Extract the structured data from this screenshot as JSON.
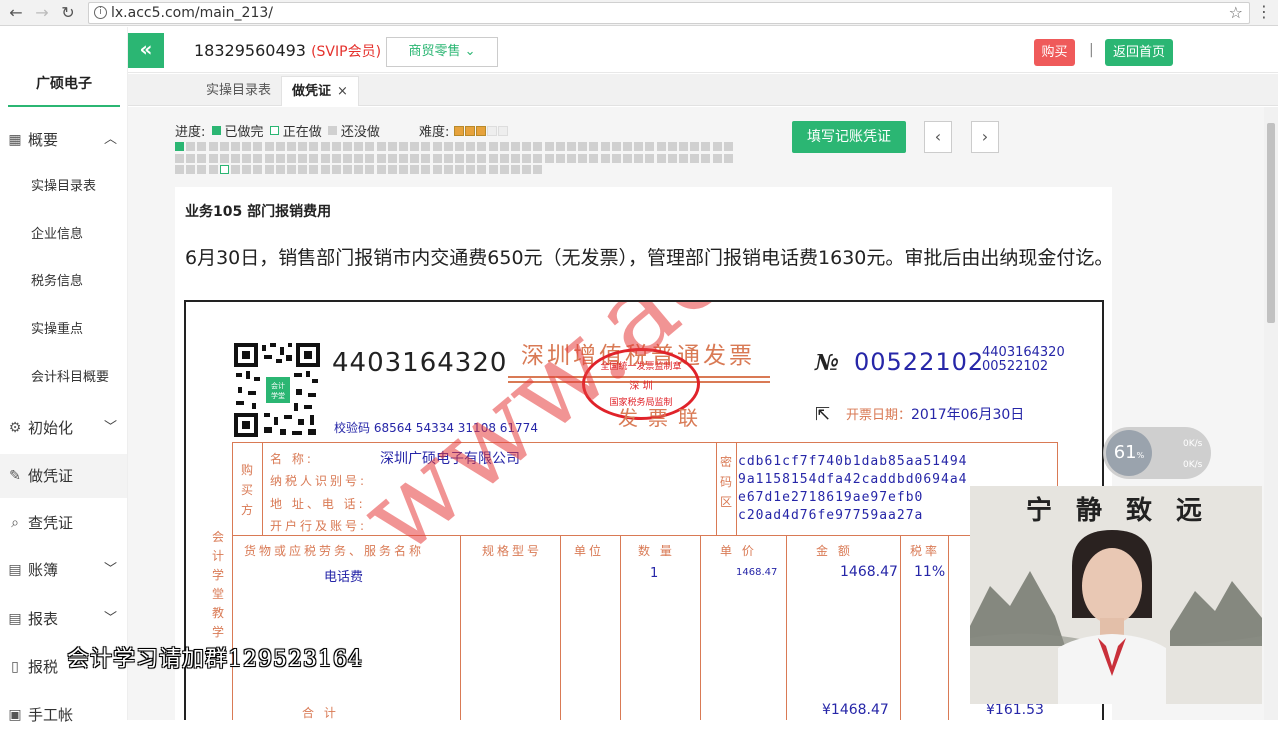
{
  "browser": {
    "url": "lx.acc5.com/main_213/"
  },
  "sidebar": {
    "brand": "广硕电子",
    "items": [
      {
        "label": "概要",
        "icon": "grid-icon"
      },
      {
        "label": "实操目录表"
      },
      {
        "label": "企业信息"
      },
      {
        "label": "税务信息"
      },
      {
        "label": "实操重点"
      },
      {
        "label": "会计科目概要"
      },
      {
        "label": "初始化",
        "icon": "gear-icon"
      },
      {
        "label": "做凭证",
        "icon": "pen-icon"
      },
      {
        "label": "查凭证",
        "icon": "search-icon"
      },
      {
        "label": "账簿",
        "icon": "book-icon"
      },
      {
        "label": "报表",
        "icon": "report-icon"
      },
      {
        "label": "报税",
        "icon": "file-icon"
      },
      {
        "label": "手工帐",
        "icon": "ledger-icon"
      }
    ]
  },
  "topbar": {
    "phone": "18329560493",
    "vip": "(SVIP会员)",
    "trade": "商贸零售",
    "buy": "购买",
    "separator": "|",
    "home": "返回首页"
  },
  "tabs": [
    {
      "label": "实操目录表"
    },
    {
      "label": "做凭证",
      "close": "×"
    }
  ],
  "progress": {
    "label": "进度:",
    "done": "已做完",
    "doing": "正在做",
    "todo": "还没做",
    "difficulty_label": "难度:",
    "difficulty": 3,
    "difficulty_max": 5,
    "done_count": 1,
    "current_index": 5,
    "colors": {
      "done": "#2bb673",
      "todo": "#d0d0d0",
      "doing_border": "#2bb673"
    }
  },
  "actions": {
    "fill": "填写记账凭证",
    "prev": "‹",
    "next": "›"
  },
  "business": {
    "title": "业务105 部门报销费用",
    "description": "6月30日，销售部门报销市内交通费650元（无发票），管理部门报销电话费1630元。审批后由出纳现金付讫。"
  },
  "invoice": {
    "code": "4403164320",
    "title": "深圳增值税普通发票",
    "copy": "发票联",
    "no_prefix": "№",
    "no": "00522102",
    "no_small_1": "4403164320",
    "no_small_2": "00522102",
    "check_code": "校验码 68564 54334 31108 61774",
    "date_label": "开票日期：",
    "date": "2017年06月30日",
    "stamp_top": "全国统一发票监制章",
    "stamp_mid": "深  圳",
    "stamp_bottom": "国家税务局监制",
    "buyer_label": "购买方",
    "buyer_name_label": "名        称:",
    "buyer_name": "深圳广硕电子有限公司",
    "tax_id_label": "纳税人识别号:",
    "address_label": "地 址、电 话:",
    "bank_label": "开户行及账号:",
    "cipher_label": "密码区",
    "cipher": [
      "cdb61cf7f740b1dab85aa51494",
      "9a1158154dfa42caddbd0694a4",
      "e67d1e2718619ae97efb0",
      "c20ad4d76fe97759aa27a"
    ],
    "side_label": "会计学堂教学",
    "columns": [
      "货物或应税劳务、服务名称",
      "规格型号",
      "单位",
      "数 量",
      "单 价",
      "金 额",
      "税率"
    ],
    "row": {
      "name": "电话费",
      "qty": "1",
      "price": "1468.47",
      "amount": "1468.47",
      "rate": "11%"
    },
    "total_label": "合        计",
    "total_amount": "¥1468.47",
    "total_tax": "¥161.53",
    "watermark": "www.acc5.com"
  },
  "overlay": {
    "speed_pct": "61",
    "speed_pct_unit": "%",
    "up": "0K/s",
    "down": "0K/s",
    "camera_calligraphy": "宁静致远",
    "group_caption": "会计学习请加群129523164"
  }
}
